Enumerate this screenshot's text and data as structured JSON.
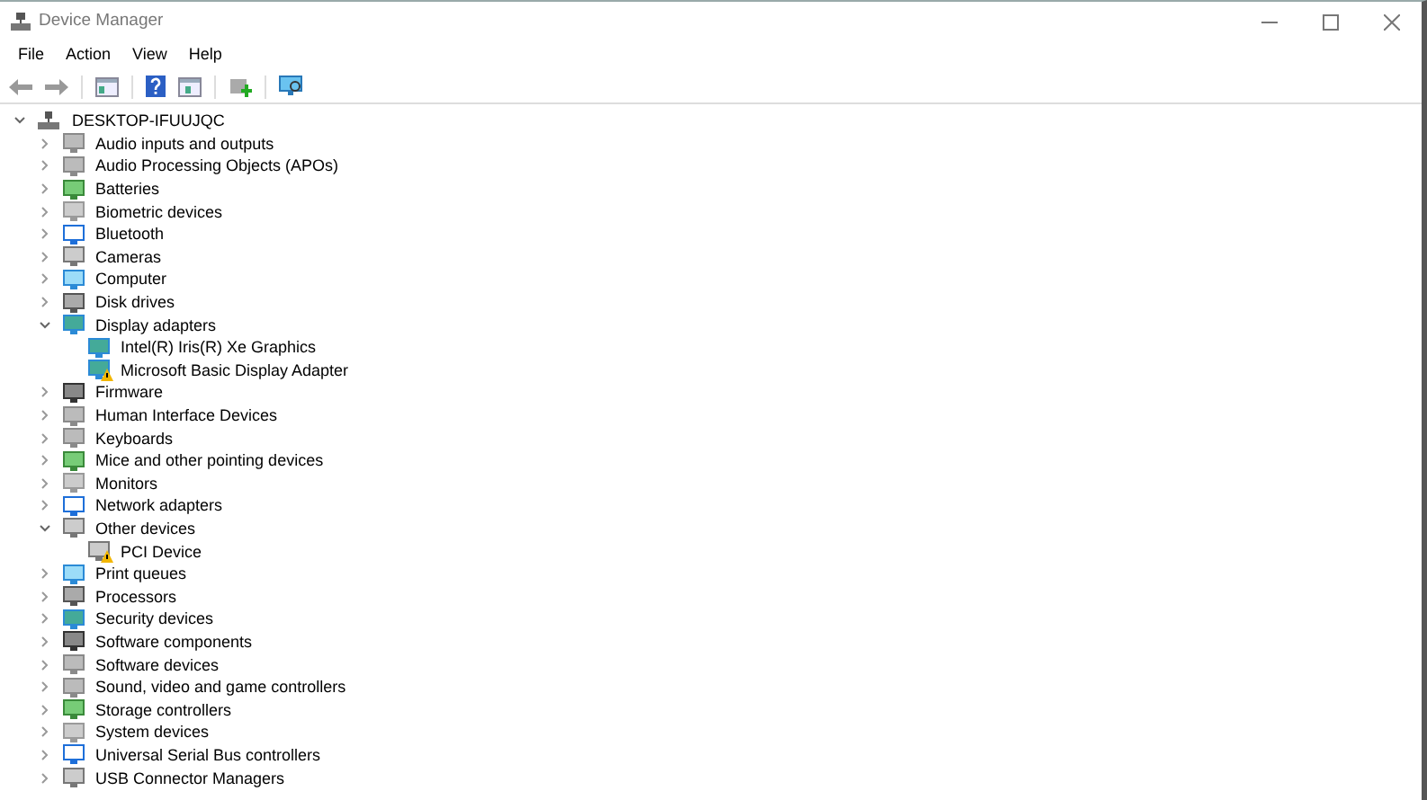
{
  "window": {
    "title": "Device Manager"
  },
  "menu": [
    "File",
    "Action",
    "View",
    "Help"
  ],
  "tree": {
    "label": "DESKTOP-IFUUJQC",
    "expanded": true,
    "children": [
      {
        "label": "Audio inputs and outputs",
        "expanded": false
      },
      {
        "label": "Audio Processing Objects (APOs)",
        "expanded": false
      },
      {
        "label": "Batteries",
        "expanded": false
      },
      {
        "label": "Biometric devices",
        "expanded": false
      },
      {
        "label": "Bluetooth",
        "expanded": false
      },
      {
        "label": "Cameras",
        "expanded": false
      },
      {
        "label": "Computer",
        "expanded": false
      },
      {
        "label": "Disk drives",
        "expanded": false
      },
      {
        "label": "Display adapters",
        "expanded": true,
        "children": [
          {
            "label": "Intel(R) Iris(R) Xe Graphics",
            "warning": false
          },
          {
            "label": "Microsoft Basic Display Adapter",
            "warning": true
          }
        ]
      },
      {
        "label": "Firmware",
        "expanded": false
      },
      {
        "label": "Human Interface Devices",
        "expanded": false
      },
      {
        "label": "Keyboards",
        "expanded": false
      },
      {
        "label": "Mice and other pointing devices",
        "expanded": false
      },
      {
        "label": "Monitors",
        "expanded": false
      },
      {
        "label": "Network adapters",
        "expanded": false
      },
      {
        "label": "Other devices",
        "expanded": true,
        "children": [
          {
            "label": "PCI Device",
            "warning": true
          }
        ]
      },
      {
        "label": "Print queues",
        "expanded": false
      },
      {
        "label": "Processors",
        "expanded": false
      },
      {
        "label": "Security devices",
        "expanded": false
      },
      {
        "label": "Software components",
        "expanded": false
      },
      {
        "label": "Software devices",
        "expanded": false
      },
      {
        "label": "Sound, video and game controllers",
        "expanded": false
      },
      {
        "label": "Storage controllers",
        "expanded": false
      },
      {
        "label": "System devices",
        "expanded": false
      },
      {
        "label": "Universal Serial Bus controllers",
        "expanded": false
      },
      {
        "label": "USB Connector Managers",
        "expanded": false
      }
    ]
  }
}
